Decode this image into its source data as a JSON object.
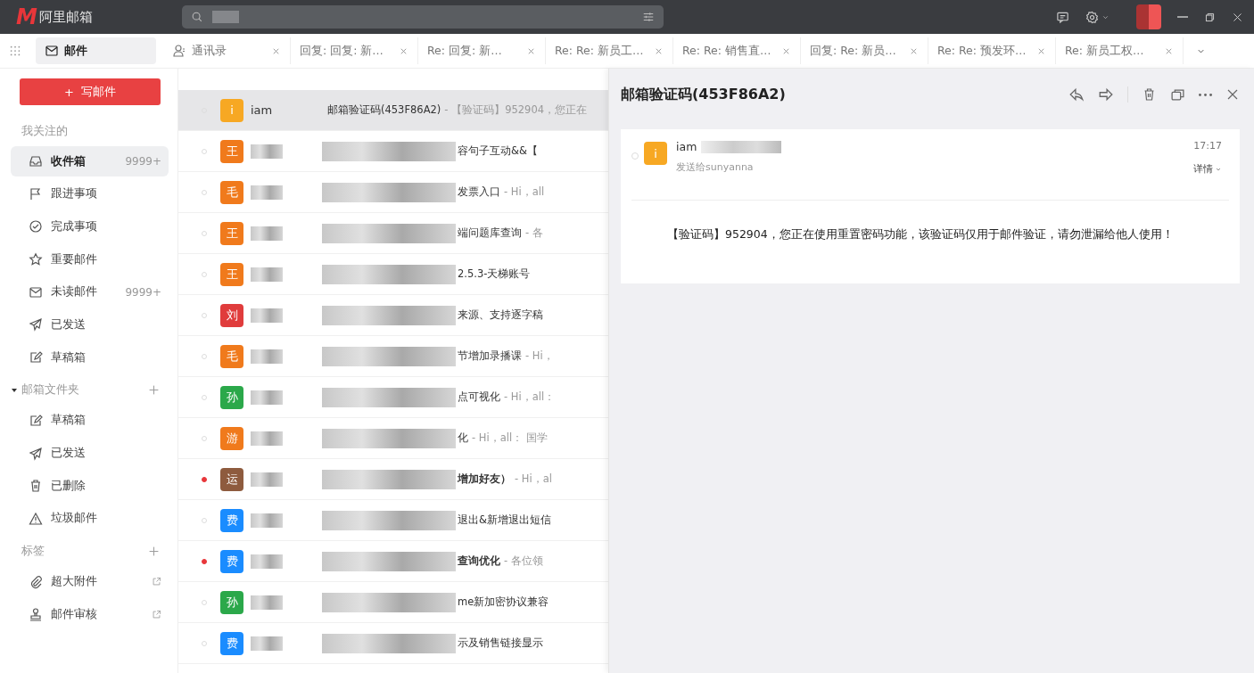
{
  "app": {
    "logo_mark": "M",
    "name": "阿里邮箱"
  },
  "tabs": [
    {
      "label": "邮件",
      "kind": "mail",
      "selected": true,
      "closable": false
    },
    {
      "label": "通讯录",
      "kind": "contacts",
      "selected": false,
      "closable": true
    },
    {
      "label": "回复: 回复: 新…",
      "kind": "message",
      "selected": false,
      "closable": true
    },
    {
      "label": "Re: 回复: 新…",
      "kind": "message",
      "selected": false,
      "closable": true
    },
    {
      "label": "Re: Re: 新员工…",
      "kind": "message",
      "selected": false,
      "closable": true
    },
    {
      "label": "Re: Re: 销售直…",
      "kind": "message",
      "selected": false,
      "closable": true
    },
    {
      "label": "回复: Re: 新员…",
      "kind": "message",
      "selected": false,
      "closable": true
    },
    {
      "label": "Re: Re: 预发环…",
      "kind": "message",
      "selected": false,
      "closable": true
    },
    {
      "label": "Re: 新员工权…",
      "kind": "message",
      "selected": false,
      "closable": true
    }
  ],
  "compose_button": {
    "icon_text": "+",
    "label": "写邮件"
  },
  "sidebar": {
    "sections": [
      {
        "title": "我关注的",
        "addable": false,
        "items": [
          {
            "label": "收件箱",
            "kind": "inbox",
            "count": "9999+",
            "selected": true
          },
          {
            "label": "跟进事项",
            "kind": "flag",
            "selected": false
          },
          {
            "label": "完成事项",
            "kind": "check",
            "selected": false
          },
          {
            "label": "重要邮件",
            "kind": "star",
            "selected": false
          },
          {
            "label": "未读邮件",
            "kind": "mail",
            "count": "9999+",
            "selected": false
          },
          {
            "label": "已发送",
            "kind": "send",
            "selected": false
          },
          {
            "label": "草稿箱",
            "kind": "draft",
            "selected": false
          }
        ]
      },
      {
        "title": "邮箱文件夹",
        "expanded": true,
        "addable": true,
        "items": [
          {
            "label": "草稿箱",
            "kind": "draft",
            "selected": false
          },
          {
            "label": "已发送",
            "kind": "send",
            "selected": false
          },
          {
            "label": "已删除",
            "kind": "trash",
            "selected": false
          },
          {
            "label": "垃圾邮件",
            "kind": "warning",
            "selected": false
          }
        ]
      },
      {
        "title": "标签",
        "addable": true,
        "items": [
          {
            "label": "超大附件",
            "kind": "clip",
            "external": true,
            "selected": false
          },
          {
            "label": "邮件审核",
            "kind": "stamp",
            "external": true,
            "selected": false
          }
        ]
      }
    ]
  },
  "mail_list": [
    {
      "avatar": "i",
      "color": "#f7a823",
      "sender": "iam",
      "subject": "邮箱验证码(453F86A2)",
      "preview": "- 【验证码】952904，您正在",
      "unread": false,
      "selected": true
    },
    {
      "avatar": "王",
      "color": "#f07a1c",
      "subject": "容句子互动&&【",
      "unread": false,
      "selected": false
    },
    {
      "avatar": "毛",
      "color": "#f07a1c",
      "subject": "发票入口",
      "preview": "- Hi，all",
      "unread": false,
      "selected": false
    },
    {
      "avatar": "王",
      "color": "#f07a1c",
      "subject": "端问题库查询",
      "preview": "- 各",
      "unread": false,
      "selected": false
    },
    {
      "avatar": "王",
      "color": "#f07a1c",
      "subject": "2.5.3-天梯账号",
      "unread": false,
      "selected": false
    },
    {
      "avatar": "刘",
      "color": "#e03c3c",
      "subject": "来源、支持逐字稿",
      "unread": false,
      "selected": false
    },
    {
      "avatar": "毛",
      "color": "#f07a1c",
      "subject": "节增加录播课",
      "preview": "- Hi，",
      "unread": false,
      "selected": false
    },
    {
      "avatar": "孙",
      "color": "#2ba84a",
      "subject": "点可视化",
      "preview": "- Hi，all：",
      "unread": false,
      "selected": false
    },
    {
      "avatar": "游",
      "color": "#f07a1c",
      "subject": "化",
      "preview": "- Hi，all：  国学",
      "unread": false,
      "selected": false
    },
    {
      "avatar": "运",
      "color": "#8e5b3e",
      "subject": "增加好友）",
      "preview": "- Hi，al",
      "unread": true,
      "selected": false
    },
    {
      "avatar": "费",
      "color": "#1a8cff",
      "subject": "退出&新增退出短信",
      "unread": false,
      "selected": false
    },
    {
      "avatar": "费",
      "color": "#1a8cff",
      "subject": "查询优化",
      "preview": "- 各位领",
      "unread": true,
      "selected": false
    },
    {
      "avatar": "孙",
      "color": "#2ba84a",
      "subject": "me新加密协议兼容",
      "unread": false,
      "selected": false
    },
    {
      "avatar": "费",
      "color": "#1a8cff",
      "subject": "示及销售链接显示",
      "unread": false,
      "selected": false
    }
  ],
  "reader": {
    "title": "邮箱验证码(453F86A2)",
    "avatar": "i",
    "color": "#f7a823",
    "sender": "iam",
    "recipient": "发送给sunyanna",
    "time": "17:17",
    "details": "详情",
    "body": "【验证码】952904，您正在使用重置密码功能，该验证码仅用于邮件验证，请勿泄漏给他人使用！"
  }
}
